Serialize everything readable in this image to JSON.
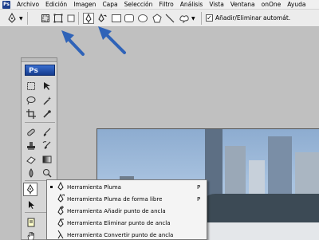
{
  "app": {
    "logo_text": "Ps",
    "menubar": [
      "Archivo",
      "Edición",
      "Imagen",
      "Capa",
      "Selección",
      "Filtro",
      "Análisis",
      "Vista",
      "Ventana",
      "onOne",
      "Ayuda"
    ]
  },
  "options_bar": {
    "add_remove_label": "Añadir/Eliminar automát.",
    "add_remove_checked": true,
    "checkmark": "✓",
    "icons": [
      "pen-tool-icon",
      "shape-layers-icon",
      "paths-icon",
      "fill-pixels-icon",
      "pen-icon",
      "freeform-pen-icon",
      "rectangle-icon",
      "rounded-rectangle-icon",
      "ellipse-icon",
      "polygon-icon",
      "line-icon",
      "custom-shape-icon"
    ]
  },
  "toolbox": {
    "logo": "Ps",
    "active_tool": "pen-tool"
  },
  "flyout": {
    "items": [
      {
        "label": "Herramienta Pluma",
        "shortcut": "P",
        "selected": true
      },
      {
        "label": "Herramienta Pluma de forma libre",
        "shortcut": "P",
        "selected": false
      },
      {
        "label": "Herramienta Añadir punto de ancla",
        "shortcut": "",
        "selected": false
      },
      {
        "label": "Herramienta Eliminar punto de ancla",
        "shortcut": "",
        "selected": false
      },
      {
        "label": "Herramienta Convertir punto de ancla",
        "shortcut": "",
        "selected": false
      }
    ]
  },
  "colors": {
    "arrow": "#2f63b8",
    "menubar_bg": "#f0f0f0",
    "workspace_bg": "#c0c0c0"
  }
}
